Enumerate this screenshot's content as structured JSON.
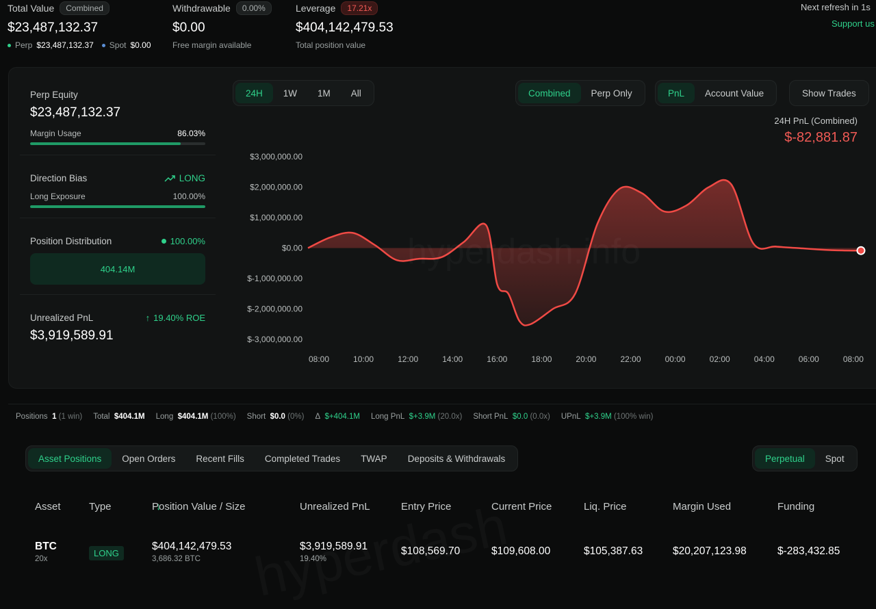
{
  "top": {
    "total_value": {
      "label": "Total Value",
      "chip": "Combined",
      "value": "$23,487,132.37",
      "perp_label": "Perp",
      "perp_value": "$23,487,132.37",
      "spot_label": "Spot",
      "spot_value": "$0.00"
    },
    "withdrawable": {
      "label": "Withdrawable",
      "chip": "0.00%",
      "value": "$0.00",
      "sub": "Free margin available"
    },
    "leverage": {
      "label": "Leverage",
      "chip": "17.21x",
      "value": "$404,142,479.53",
      "sub": "Total position value"
    },
    "next_refresh": "Next refresh in 1s",
    "support": "Support us"
  },
  "left_panel": {
    "perp_equity": {
      "label": "Perp Equity",
      "value": "$23,487,132.37",
      "margin_label": "Margin Usage",
      "margin_value": "86.03%",
      "margin_fraction": 0.8603
    },
    "direction": {
      "label": "Direction Bias",
      "bias": "LONG",
      "exposure_label": "Long Exposure",
      "exposure_value": "100.00%",
      "exposure_fraction": 1.0
    },
    "distribution": {
      "label": "Position Distribution",
      "value": "100.00%",
      "box": "404.14M"
    },
    "unrealized": {
      "label": "Unrealized PnL",
      "roe": "19.40% ROE",
      "value": "$3,919,589.91"
    }
  },
  "range_tabs": [
    "24H",
    "1W",
    "1M",
    "All"
  ],
  "view_tabs": [
    "Combined",
    "Perp Only"
  ],
  "metric_tabs": [
    "PnL",
    "Account Value"
  ],
  "show_trades": "Show Trades",
  "pnl_header": {
    "label": "24H PnL (Combined)",
    "value": "$-82,881.87"
  },
  "watermark": "hyperdash.info",
  "watermark2": "hyperdash",
  "chart_data": {
    "type": "area",
    "x": [
      "08:00",
      "09:00",
      "10:00",
      "11:00",
      "12:00",
      "13:00",
      "14:00",
      "15:00",
      "16:00",
      "16:30",
      "17:00",
      "17:30",
      "18:00",
      "19:00",
      "20:00",
      "21:00",
      "22:00",
      "23:00",
      "00:00",
      "01:00",
      "02:00",
      "03:00",
      "04:00",
      "05:00",
      "06:00",
      "07:00",
      "08:00",
      "08:50"
    ],
    "values": [
      0,
      350000,
      500000,
      100000,
      -400000,
      -350000,
      -300000,
      200000,
      750000,
      -1200000,
      -1500000,
      -2400000,
      -2500000,
      -2000000,
      -1500000,
      800000,
      1950000,
      1800000,
      1200000,
      1400000,
      2000000,
      2100000,
      150000,
      50000,
      0,
      -50000,
      -80000,
      -82881.87
    ],
    "xticks": [
      "08:00",
      "10:00",
      "12:00",
      "14:00",
      "16:00",
      "18:00",
      "20:00",
      "22:00",
      "00:00",
      "02:00",
      "04:00",
      "06:00",
      "08:00"
    ],
    "yticks": [
      "$3,000,000.00",
      "$2,000,000.00",
      "$1,000,000.00",
      "$0.00",
      "$-1,000,000.00",
      "$-2,000,000.00",
      "$-3,000,000.00"
    ],
    "ylim": [
      -3000000,
      3000000
    ],
    "color": "#f04a45",
    "grid": false
  },
  "stats_strip": {
    "positions_label": "Positions",
    "positions_value": "1",
    "positions_note": "(1 win)",
    "total_label": "Total",
    "total_value": "$404.1M",
    "long_label": "Long",
    "long_value": "$404.1M",
    "long_note": "(100%)",
    "short_label": "Short",
    "short_value": "$0.0",
    "short_note": "(0%)",
    "delta_label": "Δ",
    "delta_value": "$+404.1M",
    "longpnl_label": "Long PnL",
    "longpnl_value": "$+3.9M",
    "longpnl_note": "(20.0x)",
    "shortpnl_label": "Short PnL",
    "shortpnl_value": "$0.0",
    "shortpnl_note": "(0.0x)",
    "upnl_label": "UPnL",
    "upnl_value": "$+3.9M",
    "upnl_note": "(100% win)"
  },
  "bottom_tabs": [
    "Asset Positions",
    "Open Orders",
    "Recent Fills",
    "Completed Trades",
    "TWAP",
    "Deposits & Withdrawals"
  ],
  "market_tabs": [
    "Perpetual",
    "Spot"
  ],
  "table": {
    "headers": [
      "Asset",
      "Type",
      "Position Value / Size",
      "Unrealized PnL",
      "Entry Price",
      "Current Price",
      "Liq. Price",
      "Margin Used",
      "Funding"
    ],
    "row": {
      "asset": "BTC",
      "leverage": "20x",
      "type": "LONG",
      "position_value": "$404,142,479.53",
      "size": "3,686.32 BTC",
      "upnl": "$3,919,589.91",
      "upnl_pct": "19.40%",
      "entry": "$108,569.70",
      "current": "$109,608.00",
      "liq": "$105,387.63",
      "margin": "$20,207,123.98",
      "funding": "$-283,432.85"
    }
  }
}
